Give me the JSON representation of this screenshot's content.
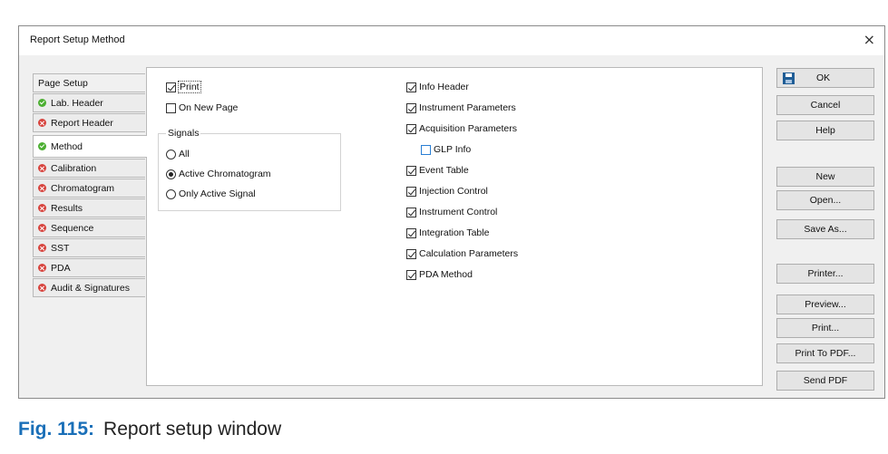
{
  "window": {
    "title": "Report Setup Method",
    "close_label": "×"
  },
  "tabs": [
    {
      "label": "Page Setup",
      "status": "none"
    },
    {
      "label": "Lab. Header",
      "status": "ok"
    },
    {
      "label": "Report Header",
      "status": "error"
    },
    {
      "label": "Method",
      "status": "ok",
      "selected": true
    },
    {
      "label": "Calibration",
      "status": "error"
    },
    {
      "label": "Chromatogram",
      "status": "error"
    },
    {
      "label": "Results",
      "status": "error"
    },
    {
      "label": "Sequence",
      "status": "error"
    },
    {
      "label": "SST",
      "status": "error"
    },
    {
      "label": "PDA",
      "status": "error"
    },
    {
      "label": "Audit & Signatures",
      "status": "error"
    }
  ],
  "left_options": {
    "print": {
      "label": "Print",
      "checked": true
    },
    "on_new_page": {
      "label": "On New Page",
      "checked": false
    }
  },
  "signals": {
    "group_label": "Signals",
    "options": [
      {
        "label": "All",
        "selected": false
      },
      {
        "label": "Active Chromatogram",
        "selected": true
      },
      {
        "label": "Only Active Signal",
        "selected": false
      }
    ]
  },
  "right_options": [
    {
      "label": "Info Header",
      "checked": true
    },
    {
      "label": "Instrument Parameters",
      "checked": true
    },
    {
      "label": "Acquisition Parameters",
      "checked": true
    },
    {
      "label": "GLP Info",
      "checked": false
    },
    {
      "label": "Event Table",
      "checked": true
    },
    {
      "label": "Injection Control",
      "checked": true
    },
    {
      "label": "Instrument Control",
      "checked": true
    },
    {
      "label": "Integration Table",
      "checked": true
    },
    {
      "label": "Calculation Parameters",
      "checked": true
    },
    {
      "label": "PDA Method",
      "checked": true
    }
  ],
  "buttons": {
    "ok": "OK",
    "cancel": "Cancel",
    "help": "Help",
    "new": "New",
    "open": "Open...",
    "save_as": "Save As...",
    "printer": "Printer...",
    "preview": "Preview...",
    "print": "Print...",
    "print_to_pdf": "Print To PDF...",
    "send_pdf": "Send PDF"
  },
  "caption": {
    "figure": "Fig. 115:",
    "text": "Report setup window"
  },
  "colors": {
    "ok_status": "#4caf32",
    "error_status": "#d7443e",
    "caption_accent": "#1a6fb8"
  }
}
